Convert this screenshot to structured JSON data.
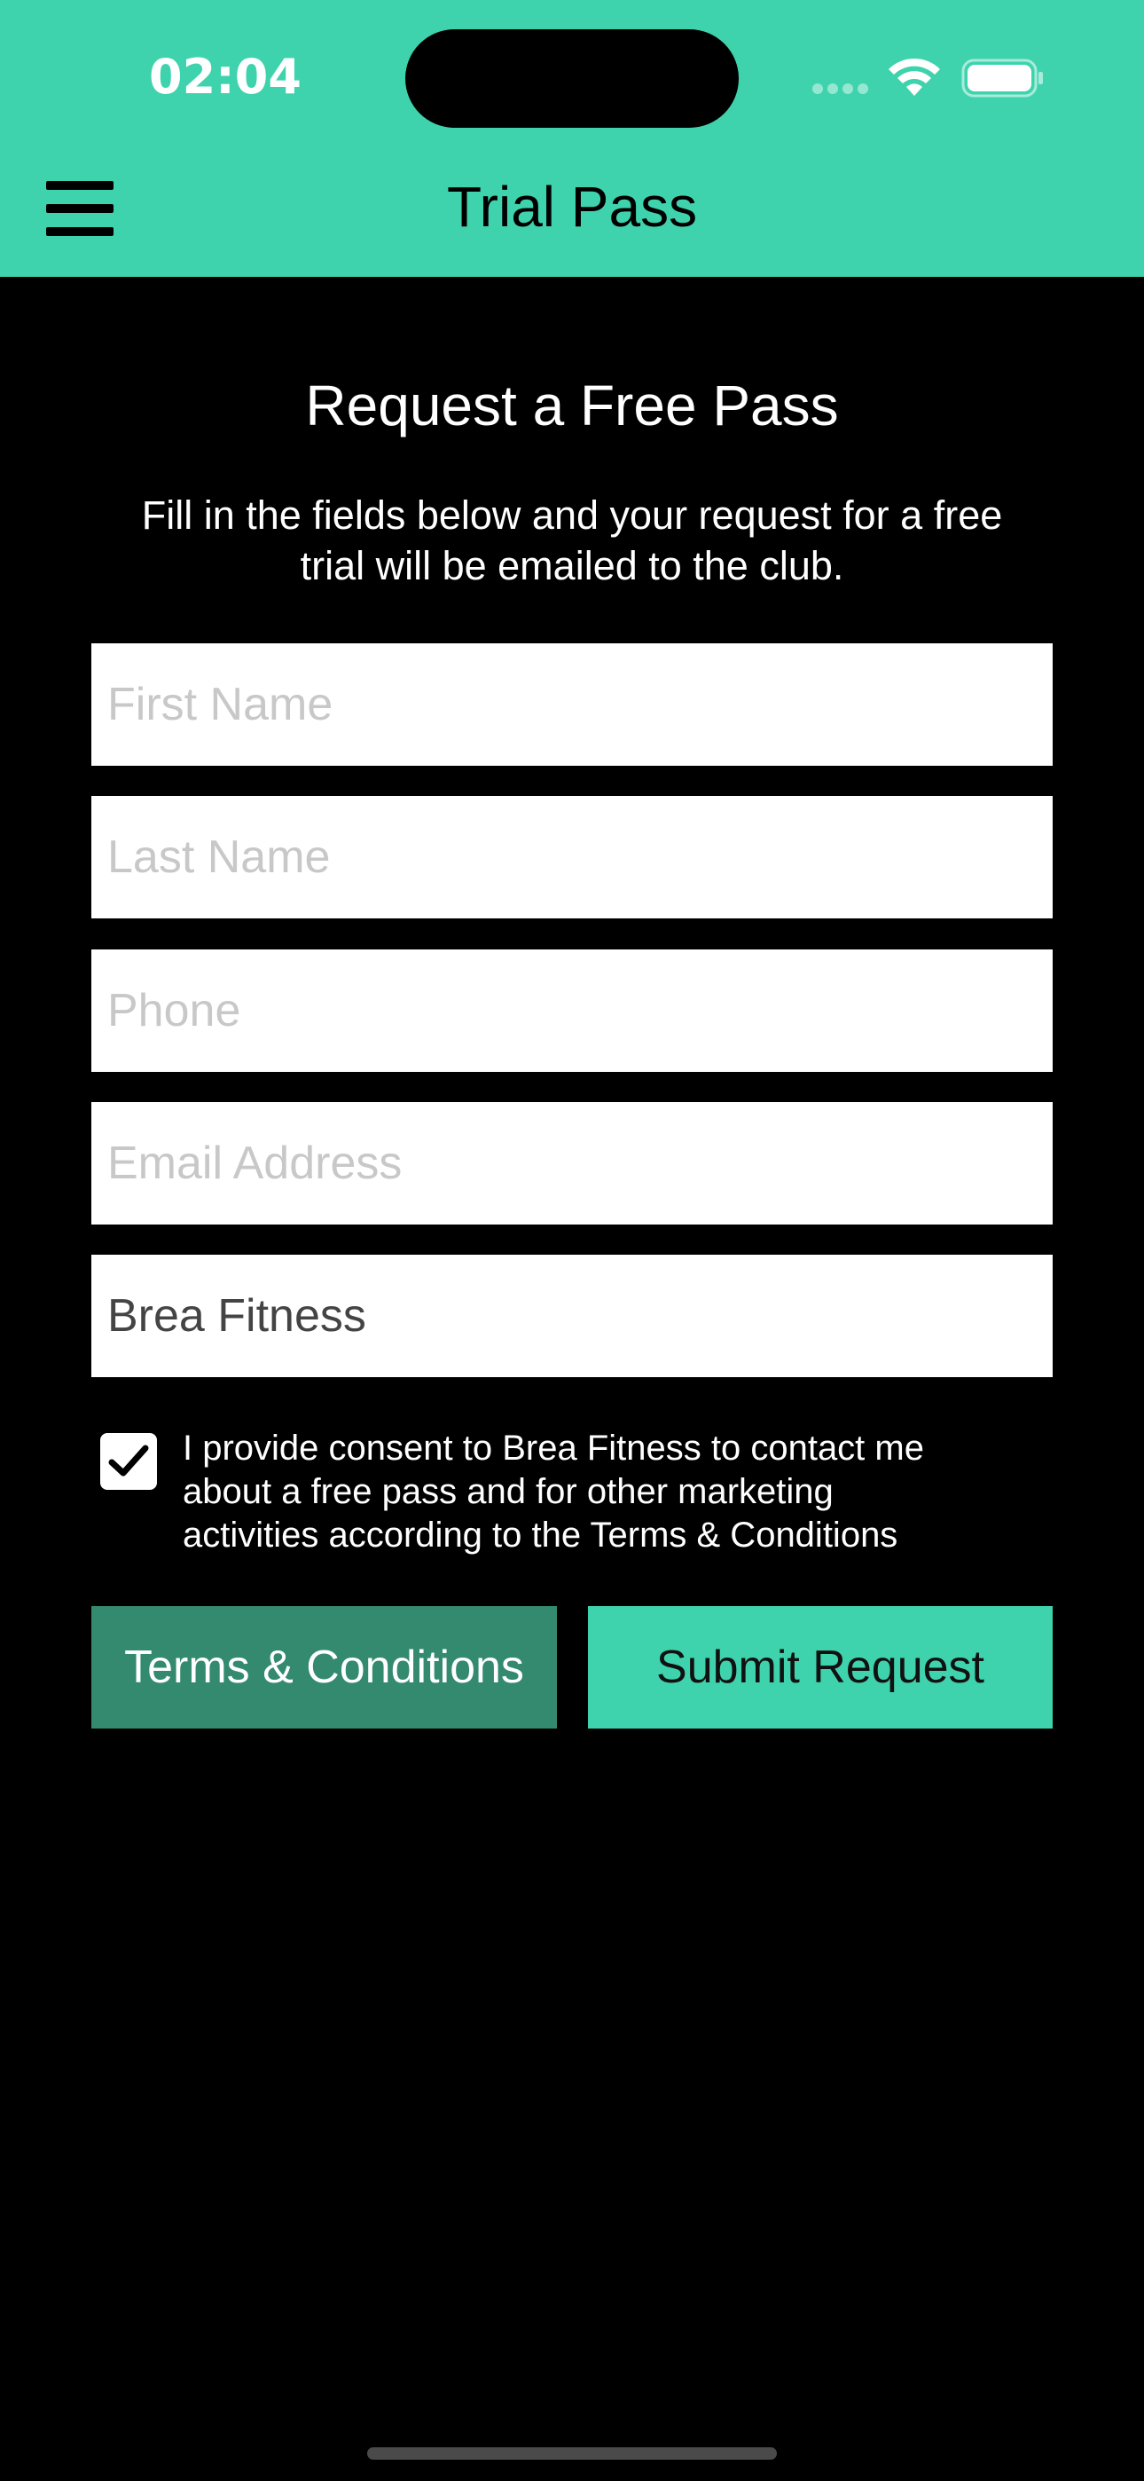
{
  "status_bar": {
    "time": "02:04"
  },
  "header": {
    "title": "Trial Pass"
  },
  "main": {
    "title": "Request a Free Pass",
    "intro_line1": "Fill in the fields below and your request for a free",
    "intro_line2": "trial will be emailed to the club.",
    "fields": {
      "first_name_placeholder": "First Name",
      "last_name_placeholder": "Last Name",
      "phone_placeholder": "Phone",
      "email_placeholder": "Email Address",
      "club_value": "Brea Fitness"
    },
    "consent": {
      "checked": true,
      "line1": "I provide consent to Brea Fitness to contact me",
      "line2": "about a free pass and for other marketing",
      "line3": "activities according to the Terms & Conditions"
    },
    "buttons": {
      "terms_label": "Terms & Conditions",
      "submit_label": "Submit Request"
    }
  },
  "colors": {
    "accent": "#3fd3ad",
    "secondary_button": "#338a6e",
    "background": "#000000"
  },
  "icons": {
    "menu": "hamburger-menu-icon",
    "check": "checkmark-icon",
    "wifi": "wifi-icon",
    "battery": "battery-icon",
    "signal": "cellular-signal-icon"
  }
}
